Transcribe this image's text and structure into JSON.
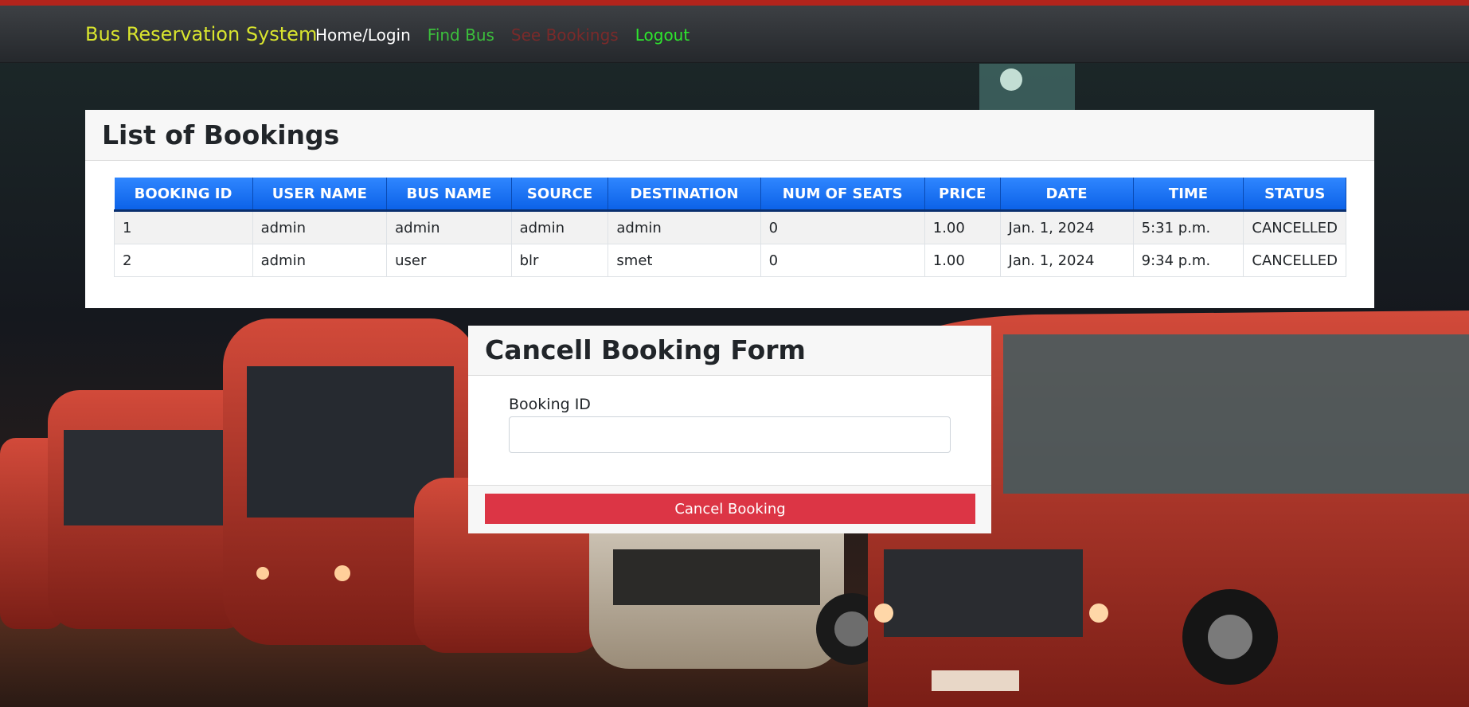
{
  "navbar": {
    "brand": "Bus Reservation System",
    "links": [
      {
        "label": "Home/Login",
        "color": "#ffffff"
      },
      {
        "label": "Find Bus",
        "color": "#3cbf3c"
      },
      {
        "label": "See Bookings",
        "color": "#7a2a2a"
      },
      {
        "label": "Logout",
        "color": "#2ee62e"
      }
    ]
  },
  "bookings": {
    "title": "List of Bookings",
    "columns": [
      "BOOKING ID",
      "USER NAME",
      "BUS NAME",
      "SOURCE",
      "DESTINATION",
      "NUM OF SEATS",
      "PRICE",
      "DATE",
      "TIME",
      "STATUS"
    ],
    "rows": [
      [
        "1",
        "admin",
        "admin",
        "admin",
        "admin",
        "0",
        "1.00",
        "Jan. 1, 2024",
        "5:31 p.m.",
        "CANCELLED"
      ],
      [
        "2",
        "admin",
        "user",
        "blr",
        "smet",
        "0",
        "1.00",
        "Jan. 1, 2024",
        "9:34 p.m.",
        "CANCELLED"
      ]
    ]
  },
  "cancel_form": {
    "title": "Cancell Booking Form",
    "booking_id_label": "Booking ID",
    "booking_id_value": "",
    "submit_label": "Cancel Booking"
  },
  "colors": {
    "accent_stripe": "#b3241c",
    "brand": "#d9e52e",
    "table_header": "#1a73f5",
    "danger": "#dc3545"
  }
}
